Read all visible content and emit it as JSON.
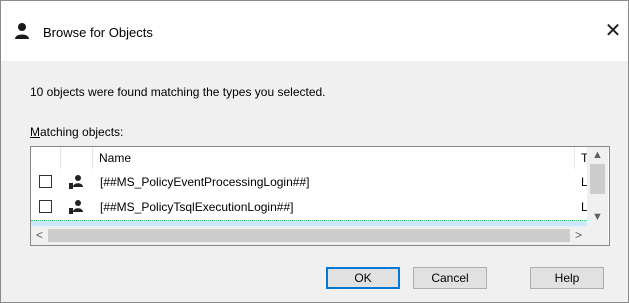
{
  "window": {
    "title": "Browse for Objects",
    "close_glyph": "✕"
  },
  "message": "10 objects were found matching the types you selected.",
  "matching": {
    "label_accel": "M",
    "label_rest": "atching objects:"
  },
  "list": {
    "columns": {
      "name": "Name",
      "type": "Typ"
    },
    "rows": [
      {
        "name": "[##MS_PolicyEventProcessingLogin##]",
        "type": "Log",
        "checked": false
      },
      {
        "name": "[##MS_PolicyTsqlExecutionLogin##]",
        "type": "Log",
        "checked": false
      }
    ]
  },
  "scroll": {
    "up": "▲",
    "down": "▼",
    "left": "<",
    "right": ">"
  },
  "buttons": {
    "ok": "OK",
    "cancel": "Cancel",
    "help": "Help"
  },
  "icons": {
    "title": "user-icon",
    "row": "login-user-icon"
  }
}
